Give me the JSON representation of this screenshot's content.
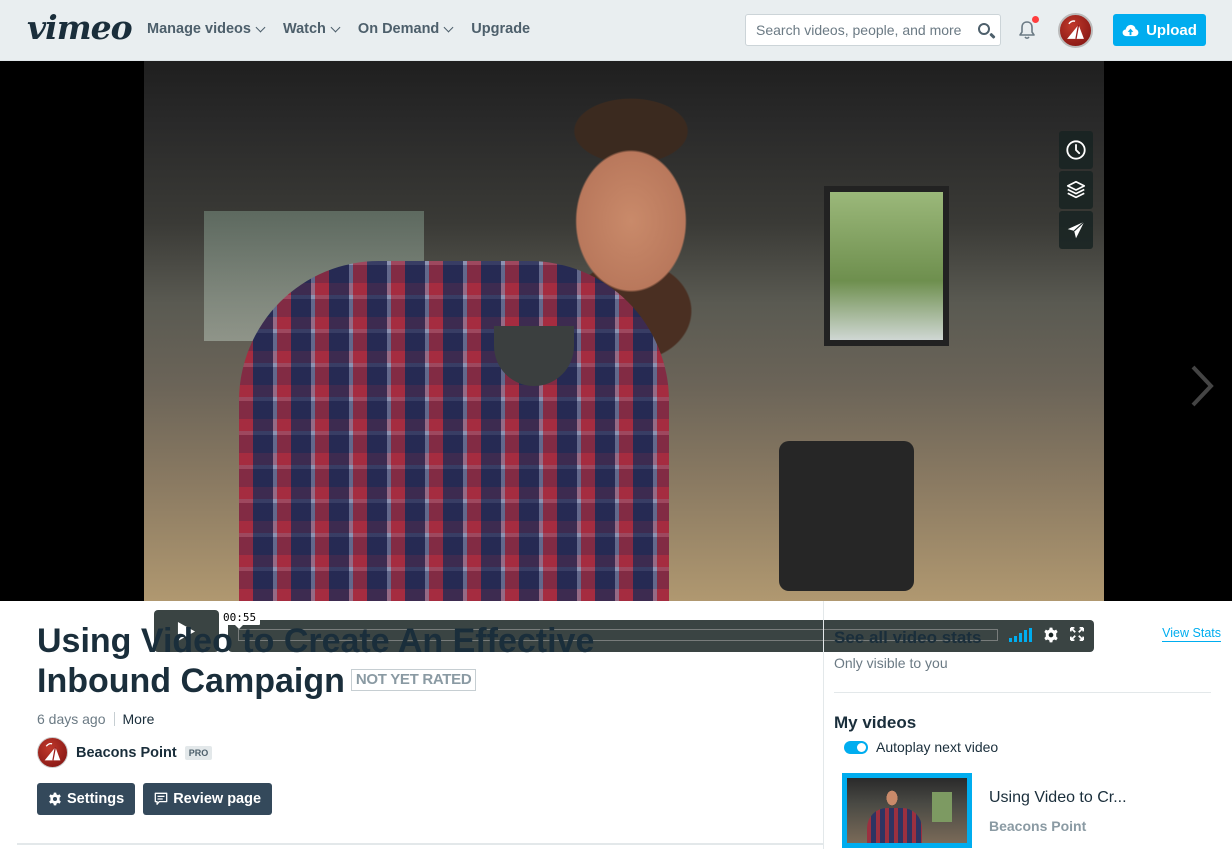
{
  "nav": {
    "logo": "vimeo",
    "links": [
      {
        "label": "Manage videos",
        "has_dropdown": true
      },
      {
        "label": "Watch",
        "has_dropdown": true
      },
      {
        "label": "On Demand",
        "has_dropdown": true
      },
      {
        "label": "Upgrade",
        "has_dropdown": false
      }
    ],
    "search_placeholder": "Search videos, people, and more",
    "search_value": "",
    "notifications_unread": true,
    "upload_label": "Upload",
    "accent": "#00adef",
    "notification_dot_color": "#ff3d3d"
  },
  "player": {
    "timecode": "00:55",
    "played_fraction": 0.0,
    "side_tools": [
      "watch-later-icon",
      "collections-icon",
      "share-icon"
    ],
    "controls": [
      "play-icon",
      "volume-icon",
      "settings-icon",
      "fullscreen-icon"
    ],
    "volume_bars": 5
  },
  "video": {
    "title": "Using Video to Create An Effective Inbound Campaign",
    "rating": "NOT YET RATED",
    "age": "6 days ago",
    "more_label": "More",
    "owner": "Beacons Point",
    "owner_badge": "PRO",
    "settings_label": "Settings",
    "review_label": "Review page"
  },
  "sidebar": {
    "stats_title": "See all video stats",
    "stats_subtitle": "Only visible to you",
    "view_stats_label": "View Stats",
    "my_videos_title": "My videos",
    "autoplay_label": "Autoplay next video",
    "autoplay_on": true,
    "videos": [
      {
        "title": "Using Video to Cr...",
        "owner": "Beacons Point",
        "active": true
      }
    ]
  }
}
